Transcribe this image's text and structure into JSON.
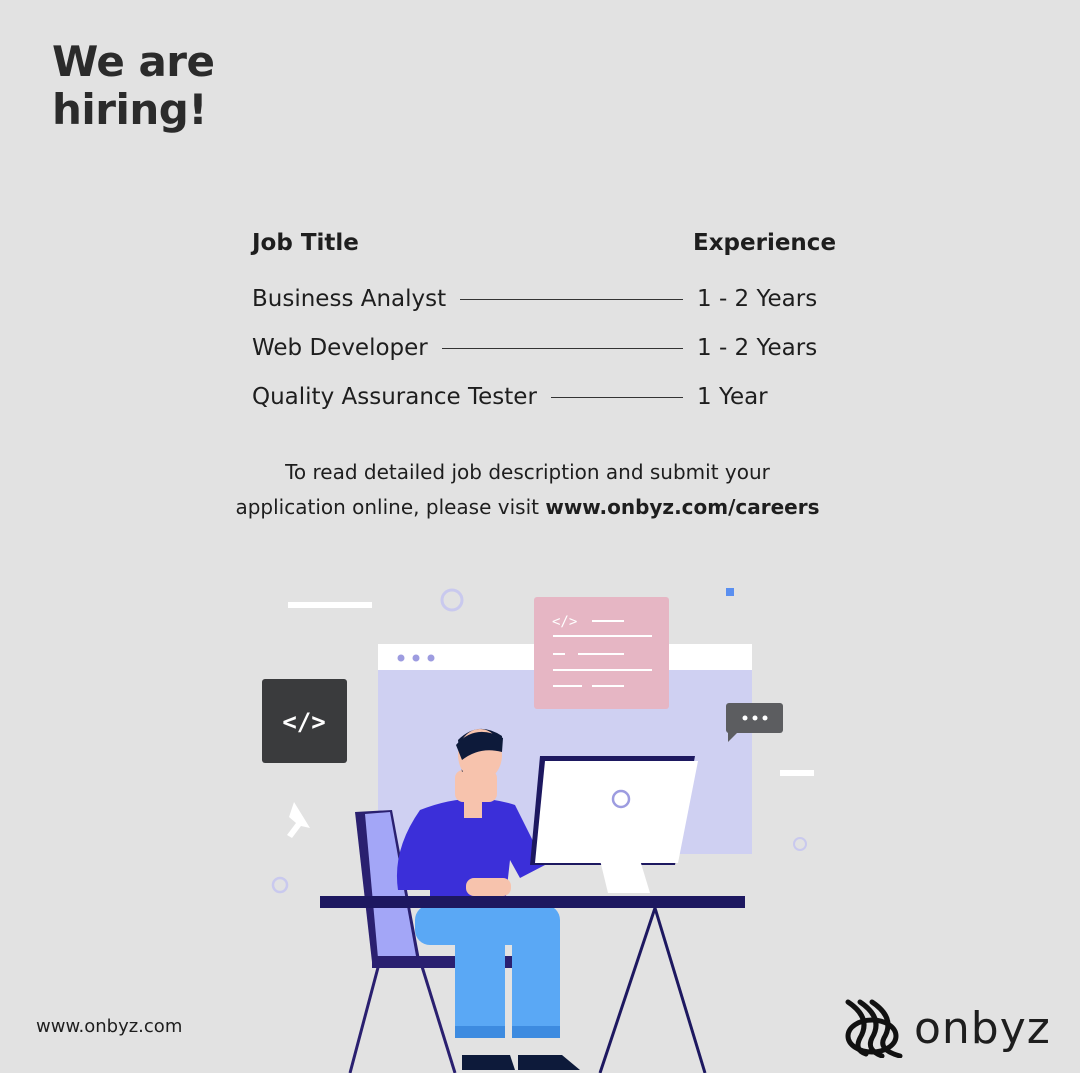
{
  "headline": {
    "line1": "We are",
    "line2": "hiring!"
  },
  "table": {
    "headers": {
      "job": "Job Title",
      "experience": "Experience"
    },
    "rows": [
      {
        "title": "Business Analyst",
        "experience": "1 - 2 Years"
      },
      {
        "title": "Web Developer",
        "experience": "1 - 2 Years"
      },
      {
        "title": "Quality Assurance Tester",
        "experience": "1 Year"
      }
    ]
  },
  "note": {
    "line1": "To read detailed job description and submit your",
    "line2": "application online, please visit ",
    "link": "www.onbyz.com/careers"
  },
  "illustration": {
    "code_tag": "</>",
    "small_code_tag": "</>"
  },
  "footer": {
    "url": "www.onbyz.com",
    "logo_text": "onbyz"
  },
  "colors": {
    "background": "#e2e2e2",
    "text": "#1e1e1e",
    "shirt": "#3b2fd9",
    "pants": "#5aa8f5",
    "screen": "#cfd0f2",
    "card": "#e6b6c4"
  }
}
